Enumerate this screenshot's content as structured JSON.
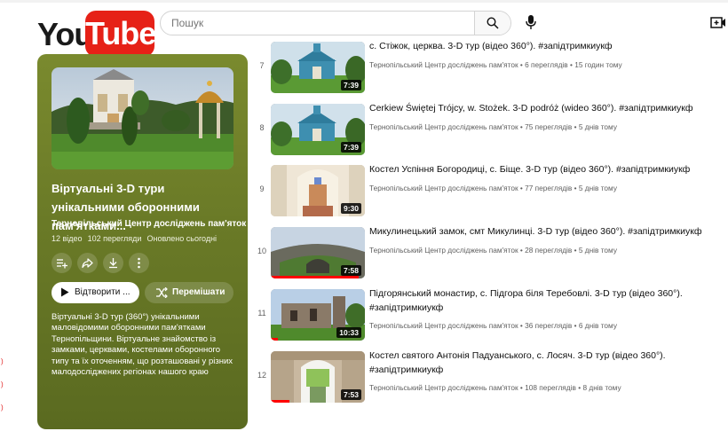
{
  "header": {
    "logo_you": "You",
    "logo_tube": "Tube",
    "search_placeholder": "Пошук"
  },
  "playlist": {
    "title": "Віртуальні 3-D тури унікальними оборонними пам'ятками...",
    "channel": "Тернопільський Центр досліджень пам'яток",
    "videos": "12 відео",
    "views": "102 перегляди",
    "updated": "Оновлено сьогодні",
    "play_label": "Відтворити ...",
    "shuffle_label": "Перемішати",
    "description": "Віртуальні 3-D тур (360°) унікальними маловідомими оборонними пам'ятками Тернопільщини. Віртуальне знайомство із замками, церквами, костелами оборонного типу та їх оточенням, що розташовані у різних малодосліджених регіонах нашого краю"
  },
  "videos": [
    {
      "index": "7",
      "title": "с. Стіжок, церква. 3-D тур (відео 360°). #запідтримкиукф",
      "channel": "Тернопільський Центр досліджень пам'яток",
      "views": "6 переглядів",
      "age": "15 годин тому",
      "duration": "7:39",
      "progress": 0.0
    },
    {
      "index": "8",
      "title": "Cerkiew Świętej Trójcy, w. Stożek. 3-D podróż (wideo 360°). #запідтримкиукф",
      "channel": "Тернопільський Центр досліджень пам'яток",
      "views": "75 переглядів",
      "age": "5 днів тому",
      "duration": "7:39",
      "progress": 0.0
    },
    {
      "index": "9",
      "title": "Костел Успіння Богородиці, с. Біще. 3-D тур (відео 360°). #запідтримкиукф",
      "channel": "Тернопільський Центр досліджень пам'яток",
      "views": "77 переглядів",
      "age": "5 днів тому",
      "duration": "9:30",
      "progress": 0.0
    },
    {
      "index": "10",
      "title": "Микулинецький замок, смт Микулинці. 3-D тур (відео 360°). #запідтримкиукф",
      "channel": "Тернопільський Центр досліджень пам'яток",
      "views": "28 переглядів",
      "age": "5 днів тому",
      "duration": "7:58",
      "progress": 0.93
    },
    {
      "index": "11",
      "title": "Підгорянський монастир, с. Підгора біля Теребовлі. 3-D тур (відео 360°). #запідтримкиукф",
      "channel": "Тернопільський Центр досліджень пам'яток",
      "views": "36 переглядів",
      "age": "6 днів тому",
      "duration": "10:33",
      "progress": 0.08
    },
    {
      "index": "12",
      "title": "Костел святого Антонія Падуанського, с. Лосяч. 3-D тур (відео 360°). #запідтримкиукф",
      "channel": "Тернопільський Центр досліджень пам'яток",
      "views": "108 переглядів",
      "age": "8 днів тому",
      "duration": "7:53",
      "progress": 0.2
    }
  ],
  "sep": "•",
  "icons": [
    "search-icon",
    "mic-icon",
    "create-video-icon",
    "add-to-queue-icon",
    "share-icon",
    "download-icon",
    "more-icon",
    "play-icon",
    "shuffle-icon"
  ]
}
